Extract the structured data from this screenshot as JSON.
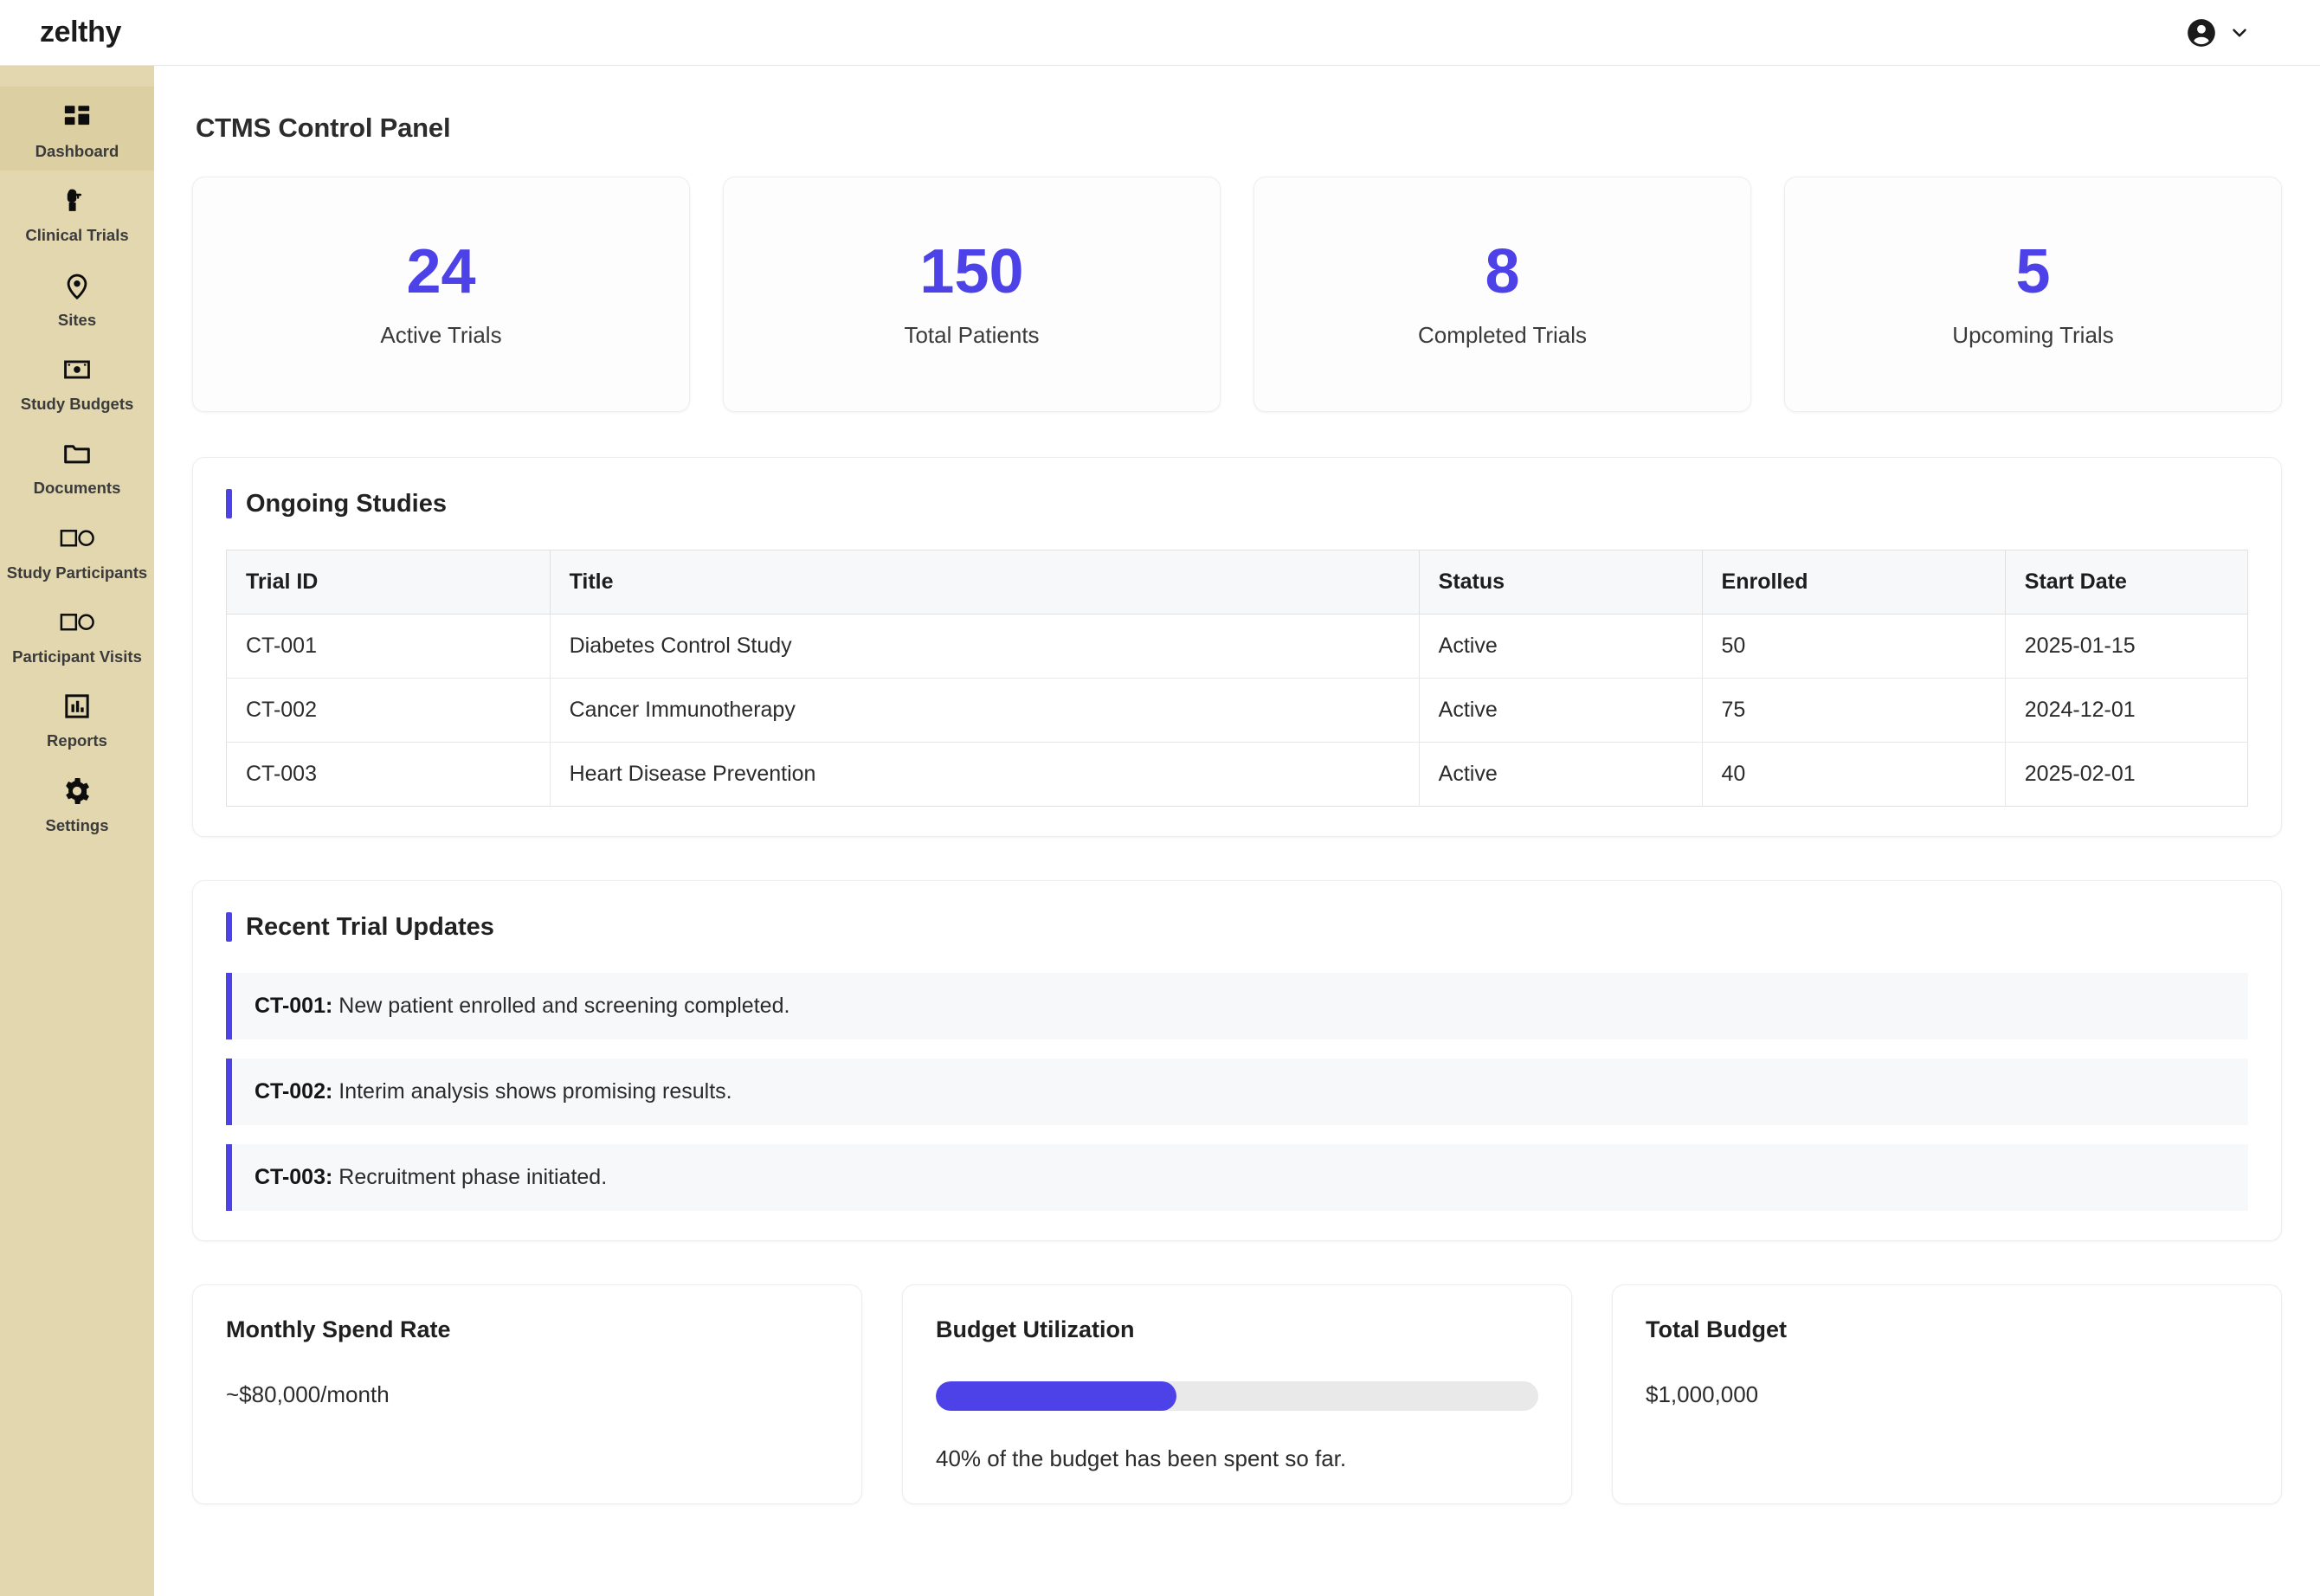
{
  "brand": {
    "logo_text": "zelthy",
    "accent_color": "#4d42e8",
    "sidebar_color": "#e2d7ae"
  },
  "header": {
    "avatar_icon": "account-circle-icon",
    "chevron_icon": "chevron-down-icon"
  },
  "sidebar": {
    "items": [
      {
        "label": "Dashboard",
        "icon": "dashboard-grid-icon",
        "active": true
      },
      {
        "label": "Clinical Trials",
        "icon": "clinical-trials-icon",
        "active": false
      },
      {
        "label": "Sites",
        "icon": "map-pin-icon",
        "active": false
      },
      {
        "label": "Study Budgets",
        "icon": "banknote-icon",
        "active": false
      },
      {
        "label": "Documents",
        "icon": "folder-icon",
        "active": false
      },
      {
        "label": "Study Participants",
        "icon": "square-circle-icon",
        "active": false
      },
      {
        "label": "Participant Visits",
        "icon": "square-circle-icon",
        "active": false
      },
      {
        "label": "Reports",
        "icon": "bar-chart-icon",
        "active": false
      },
      {
        "label": "Settings",
        "icon": "gear-icon",
        "active": false
      }
    ]
  },
  "main": {
    "page_title": "CTMS Control Panel",
    "stats": [
      {
        "value": "24",
        "label": "Active Trials"
      },
      {
        "value": "150",
        "label": "Total Patients"
      },
      {
        "value": "8",
        "label": "Completed Trials"
      },
      {
        "value": "5",
        "label": "Upcoming Trials"
      }
    ],
    "ongoing_studies": {
      "title": "Ongoing Studies",
      "columns": [
        "Trial ID",
        "Title",
        "Status",
        "Enrolled",
        "Start Date"
      ],
      "rows": [
        {
          "trial_id": "CT-001",
          "title": "Diabetes Control Study",
          "status": "Active",
          "enrolled": "50",
          "start_date": "2025-01-15"
        },
        {
          "trial_id": "CT-002",
          "title": "Cancer Immunotherapy",
          "status": "Active",
          "enrolled": "75",
          "start_date": "2024-12-01"
        },
        {
          "trial_id": "CT-003",
          "title": "Heart Disease Prevention",
          "status": "Active",
          "enrolled": "40",
          "start_date": "2025-02-01"
        }
      ]
    },
    "recent_updates": {
      "title": "Recent Trial Updates",
      "items": [
        {
          "trial_id": "CT-001:",
          "text": " New patient enrolled and screening completed."
        },
        {
          "trial_id": "CT-002:",
          "text": " Interim analysis shows promising results."
        },
        {
          "trial_id": "CT-003:",
          "text": " Recruitment phase initiated."
        }
      ]
    },
    "budget": {
      "monthly_spend": {
        "title": "Monthly Spend Rate",
        "value": "~$80,000/month"
      },
      "utilization": {
        "title": "Budget Utilization",
        "percent": 40,
        "note": "40% of the budget has been spent so far."
      },
      "total_budget": {
        "title": "Total Budget",
        "value": "$1,000,000"
      }
    }
  }
}
